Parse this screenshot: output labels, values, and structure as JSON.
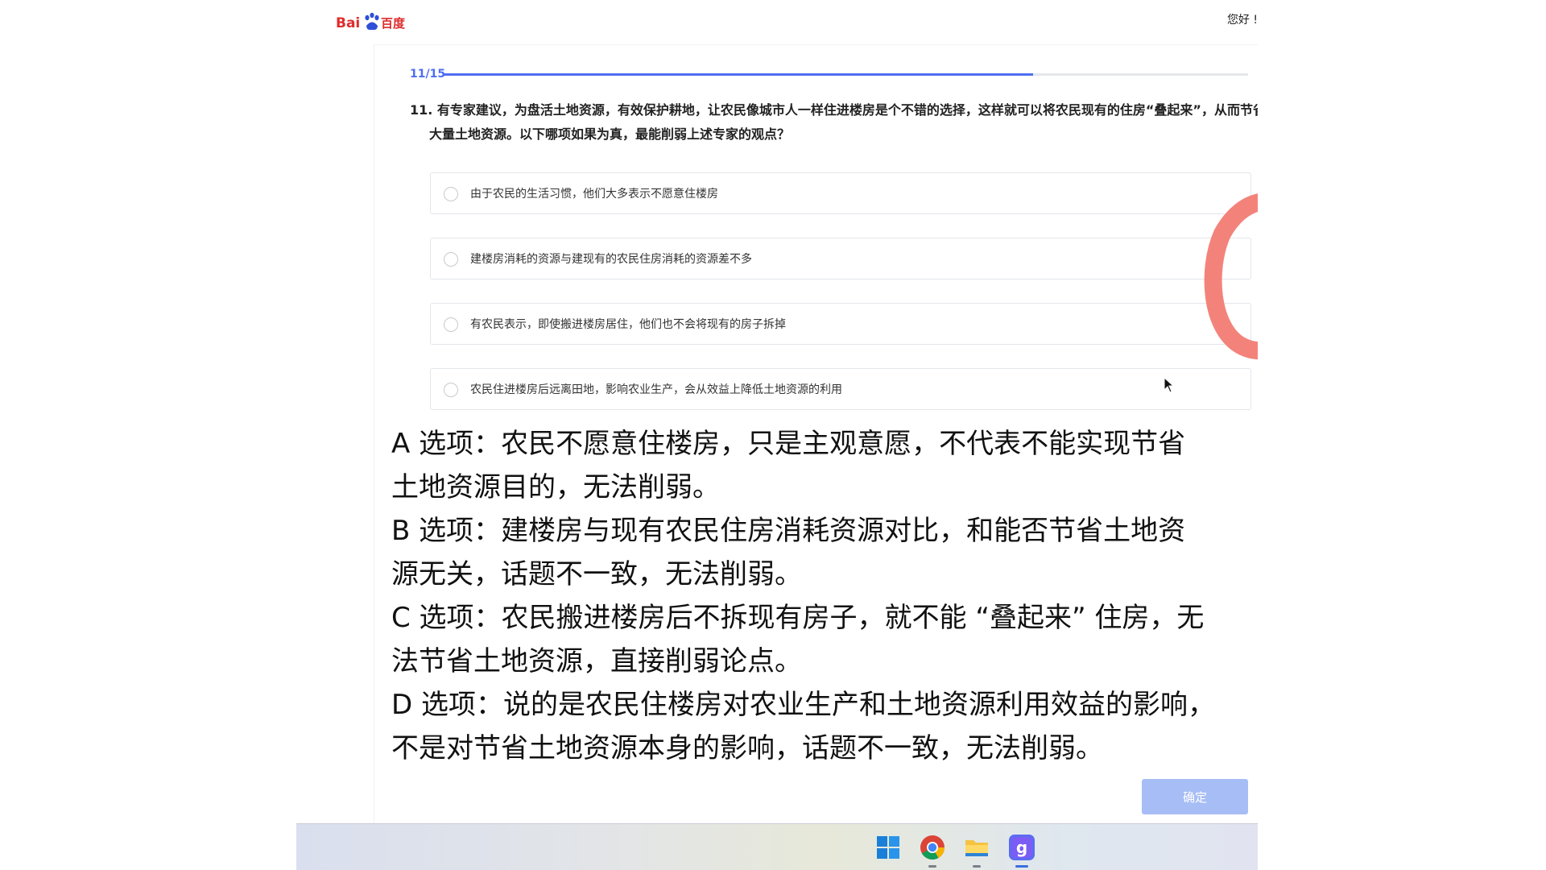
{
  "header": {
    "logo_text": "Bai百度",
    "greeting": "您好 !"
  },
  "progress": {
    "label": "11/15",
    "fraction": 0.733
  },
  "question": {
    "text": "11. 有专家建议，为盘活土地资源，有效保护耕地，让农民像城市人一样住进楼房是个不错的选择，这样就可以将农民现有的住房“叠起来”，从而节省大量土地资源。以下哪项如果为真，最能削弱上述专家的观点？"
  },
  "options": [
    {
      "text": "由于农民的生活习惯，他们大多表示不愿意住楼房"
    },
    {
      "text": "建楼房消耗的资源与建现有的农民住房消耗的资源差不多"
    },
    {
      "text": "有农民表示，即使搬进楼房居住，他们也不会将现有的房子拆掉"
    },
    {
      "text": "农民住进楼房后远离田地，影响农业生产，会从效益上降低土地资源的利用"
    }
  ],
  "answer_mark": "C",
  "explanation": [
    "A 选项：农民不愿意住楼房，只是主观意愿，不代表不能实现节省",
    "土地资源目的，无法削弱。",
    "B 选项：建楼房与现有农民住房消耗资源对比，和能否节省土地资",
    "源无关，话题不一致，无法削弱。",
    "C 选项：农民搬进楼房后不拆现有房子，就不能 “叠起来” 住房，无",
    "法节省土地资源，直接削弱论点。",
    "D 选项：说的是农民住楼房对农业生产和土地资源利用效益的影响，",
    "不是对节省土地资源本身的影响，话题不一致，无法削弱。"
  ],
  "confirm_button": "确定",
  "taskbar": {
    "icons": [
      "windows-start-icon",
      "chrome-icon",
      "file-explorer-icon",
      "app-icon"
    ]
  },
  "colors": {
    "accent": "#4e6ef2",
    "button": "#a7bdf5",
    "answer_mark": "#f3837a"
  }
}
